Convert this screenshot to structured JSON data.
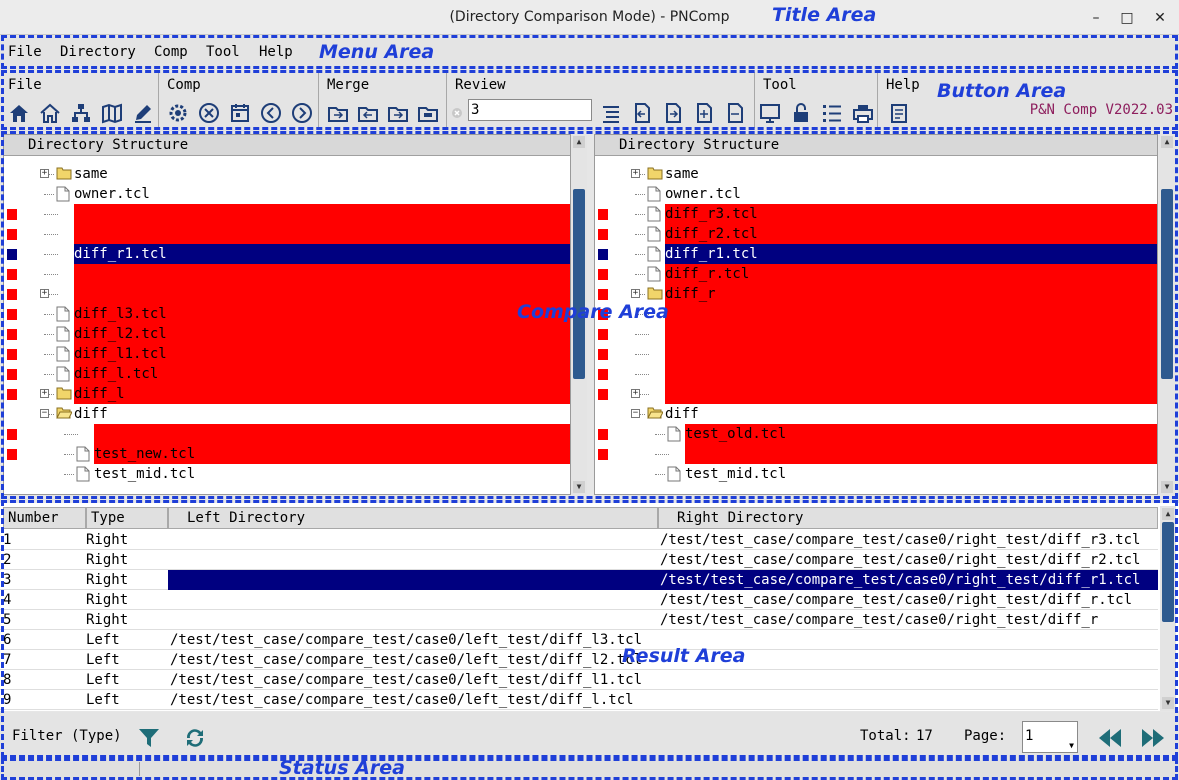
{
  "annotations": {
    "title_area": "Title Area",
    "menu_area": "Menu Area",
    "button_area": "Button Area",
    "compare_area": "Compare Area",
    "result_area": "Result Area",
    "status_area": "Status Area"
  },
  "window": {
    "title": "(Directory Comparison Mode) - PNComp",
    "minimize": "–",
    "maximize": "□",
    "close": "✕"
  },
  "menu": [
    "File",
    "Directory",
    "Comp",
    "Tool",
    "Help"
  ],
  "toolbar": {
    "groups": {
      "file": "File",
      "comp": "Comp",
      "merge": "Merge",
      "review": "Review",
      "tool": "Tool",
      "help": "Help"
    },
    "review_value": "3",
    "version": "P&N Comp V2022.03"
  },
  "compare": {
    "left_header": "Directory Structure",
    "right_header": "Directory Structure",
    "left_rows": [
      {
        "label": "same",
        "kind": "folder",
        "expand": "+",
        "depth": 1,
        "diff": false
      },
      {
        "label": "owner.tcl",
        "kind": "file",
        "depth": 1,
        "diff": false
      },
      {
        "label": "",
        "kind": "none",
        "depth": 1,
        "diff": true
      },
      {
        "label": "",
        "kind": "none",
        "depth": 1,
        "diff": true
      },
      {
        "label": "diff_r1.tcl",
        "kind": "none",
        "depth": 1,
        "diff": true,
        "selected": true
      },
      {
        "label": "",
        "kind": "none",
        "depth": 1,
        "diff": true
      },
      {
        "label": "",
        "kind": "none",
        "expand": "+",
        "depth": 1,
        "diff": true
      },
      {
        "label": "diff_l3.tcl",
        "kind": "file",
        "depth": 1,
        "diff": true
      },
      {
        "label": "diff_l2.tcl",
        "kind": "file",
        "depth": 1,
        "diff": true
      },
      {
        "label": "diff_l1.tcl",
        "kind": "file",
        "depth": 1,
        "diff": true
      },
      {
        "label": "diff_l.tcl",
        "kind": "file",
        "depth": 1,
        "diff": true
      },
      {
        "label": "diff_l",
        "kind": "folder",
        "expand": "+",
        "depth": 1,
        "diff": true
      },
      {
        "label": "diff",
        "kind": "folder-open",
        "expand": "−",
        "depth": 1,
        "diff": false
      },
      {
        "label": "",
        "kind": "none",
        "depth": 2,
        "diff": true
      },
      {
        "label": "test_new.tcl",
        "kind": "file",
        "depth": 2,
        "diff": true
      },
      {
        "label": "test_mid.tcl",
        "kind": "file",
        "depth": 2,
        "diff": false
      }
    ],
    "right_rows": [
      {
        "label": "same",
        "kind": "folder",
        "expand": "+",
        "depth": 1,
        "diff": false
      },
      {
        "label": "owner.tcl",
        "kind": "file",
        "depth": 1,
        "diff": false
      },
      {
        "label": "diff_r3.tcl",
        "kind": "file",
        "depth": 1,
        "diff": true
      },
      {
        "label": "diff_r2.tcl",
        "kind": "file",
        "depth": 1,
        "diff": true
      },
      {
        "label": "diff_r1.tcl",
        "kind": "file",
        "depth": 1,
        "diff": true,
        "selected": true
      },
      {
        "label": "diff_r.tcl",
        "kind": "file",
        "depth": 1,
        "diff": true
      },
      {
        "label": "diff_r",
        "kind": "folder",
        "expand": "+",
        "depth": 1,
        "diff": true
      },
      {
        "label": "",
        "kind": "none",
        "depth": 1,
        "diff": true
      },
      {
        "label": "",
        "kind": "none",
        "depth": 1,
        "diff": true
      },
      {
        "label": "",
        "kind": "none",
        "depth": 1,
        "diff": true
      },
      {
        "label": "",
        "kind": "none",
        "depth": 1,
        "diff": true
      },
      {
        "label": "",
        "kind": "none",
        "expand": "+",
        "depth": 1,
        "diff": true
      },
      {
        "label": "diff",
        "kind": "folder-open",
        "expand": "−",
        "depth": 1,
        "diff": false
      },
      {
        "label": "test_old.tcl",
        "kind": "file",
        "depth": 2,
        "diff": true
      },
      {
        "label": "",
        "kind": "none",
        "depth": 2,
        "diff": true
      },
      {
        "label": "test_mid.tcl",
        "kind": "file",
        "depth": 2,
        "diff": false
      }
    ]
  },
  "result": {
    "headers": [
      "Number",
      "Type",
      "Left Directory",
      "Right Directory"
    ],
    "rows": [
      {
        "number": "1",
        "type": "Right",
        "left": "",
        "right": "/test/test_case/compare_test/case0/right_test/diff_r3.tcl"
      },
      {
        "number": "2",
        "type": "Right",
        "left": "",
        "right": "/test/test_case/compare_test/case0/right_test/diff_r2.tcl"
      },
      {
        "number": "3",
        "type": "Right",
        "left": "",
        "right": "/test/test_case/compare_test/case0/right_test/diff_r1.tcl",
        "selected": true
      },
      {
        "number": "4",
        "type": "Right",
        "left": "",
        "right": "/test/test_case/compare_test/case0/right_test/diff_r.tcl"
      },
      {
        "number": "5",
        "type": "Right",
        "left": "",
        "right": "/test/test_case/compare_test/case0/right_test/diff_r"
      },
      {
        "number": "6",
        "type": "Left",
        "left": "/test/test_case/compare_test/case0/left_test/diff_l3.tcl",
        "right": ""
      },
      {
        "number": "7",
        "type": "Left",
        "left": "/test/test_case/compare_test/case0/left_test/diff_l2.tcl",
        "right": ""
      },
      {
        "number": "8",
        "type": "Left",
        "left": "/test/test_case/compare_test/case0/left_test/diff_l1.tcl",
        "right": ""
      },
      {
        "number": "9",
        "type": "Left",
        "left": "/test/test_case/compare_test/case0/left_test/diff_l.tcl",
        "right": ""
      }
    ]
  },
  "filter": {
    "label": "Filter (Type)",
    "total_label": "Total:",
    "total": "17",
    "page_label": "Page:",
    "page": "1"
  },
  "colors": {
    "diff": "#ff0000",
    "selected": "#000080",
    "annotation": "#1f3fd8"
  }
}
